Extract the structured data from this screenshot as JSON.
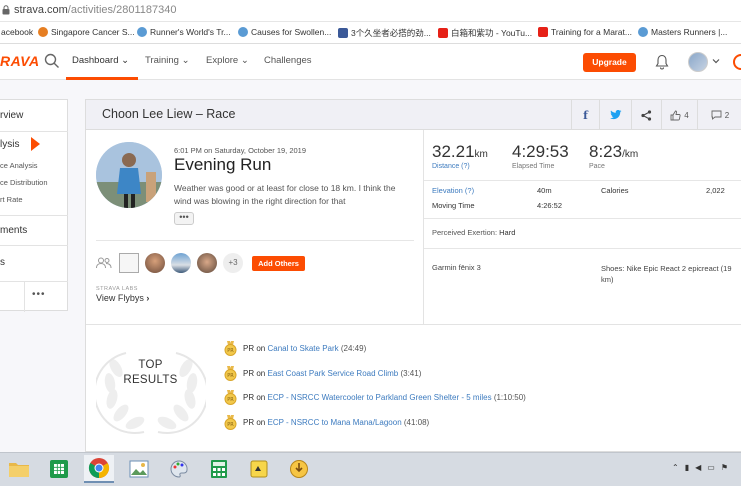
{
  "browser": {
    "url_host": "strava.com",
    "url_path": "/activities/2801187340",
    "bookmarks": [
      {
        "label": "acebook",
        "color": "#3b5998"
      },
      {
        "label": "Singapore Cancer S...",
        "color": "#e67e22"
      },
      {
        "label": "Runner's World's Tr...",
        "color": "#5a9bd4"
      },
      {
        "label": "Causes for Swollen...",
        "color": "#5a9bd4"
      },
      {
        "label": "3个久坐者必搭的劲...",
        "color": "#3b5998"
      },
      {
        "label": "白箱和紫功 - YouTu...",
        "color": "#e62117"
      },
      {
        "label": "Training for a Marat...",
        "color": "#e62117"
      },
      {
        "label": "Masters Runners |...",
        "color": "#5a9bd4"
      }
    ]
  },
  "nav": {
    "logo": "RAVA",
    "menus": [
      "Dashboard",
      "Training",
      "Explore",
      "Challenges"
    ],
    "upgrade": "Upgrade",
    "accent": "#fc4c02"
  },
  "sidebar": {
    "items": [
      "rview",
      "lysis",
      "ments",
      "s"
    ],
    "sub_items": [
      "ce Analysis",
      "ce Distribution",
      "rt Rate"
    ],
    "more": "•••"
  },
  "activity": {
    "header_title": "Choon Lee Liew – Race",
    "kudos_count": "4",
    "comment_count": "2",
    "date": "6:01 PM on Saturday, October 19, 2019",
    "name": "Evening Run",
    "description": "Weather was good or at least for close to 18 km. I think the wind was blowing in the right direction for that",
    "more": "•••",
    "extra_kudos": "+3",
    "add_others": "Add Others",
    "labs": "STRAVA LABS",
    "flybys": "View Flybys"
  },
  "stats": {
    "distance": {
      "value": "32.21",
      "unit": "km",
      "label": "Distance (?)"
    },
    "elapsed": {
      "value": "4:29:53",
      "label": "Elapsed Time"
    },
    "pace": {
      "value": "8:23",
      "unit": "/km",
      "label": "Pace"
    },
    "elevation_label": "Elevation (?)",
    "elevation_value": "40m",
    "calories_label": "Calories",
    "calories_value": "2,022",
    "moving_label": "Moving Time",
    "moving_value": "4:26:52",
    "exertion_label": "Perceived Exertion:",
    "exertion_value": "Hard",
    "device": "Garmin fēnix 3",
    "shoes_label": "Shoes:",
    "shoes_value": "Nike Epic React 2 epicreact (19",
    "shoes_unit": "km)"
  },
  "results": {
    "title_line1": "TOP",
    "title_line2": "RESULTS",
    "items": [
      {
        "pr": "PR",
        "on": "on",
        "segment": "Canal to Skate Park",
        "time": "(24:49)"
      },
      {
        "pr": "PR",
        "on": "on",
        "segment": "East Coast Park Service Road Climb",
        "time": "(3:41)"
      },
      {
        "pr": "PR",
        "on": "on",
        "segment": "ECP - NSRCC Watercooler to Parkland Green Shelter - 5 miles",
        "time": "(1:10:50)"
      },
      {
        "pr": "PR",
        "on": "on",
        "segment": "ECP - NSRCC to Mana Mana/Lagoon",
        "time": "(41:08)"
      }
    ]
  }
}
